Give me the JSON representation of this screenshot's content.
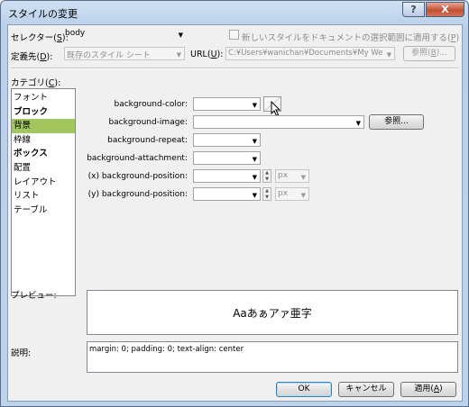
{
  "window": {
    "title": "スタイルの変更",
    "help_label": "?",
    "close_label": "X"
  },
  "selector": {
    "label": "セレクター(",
    "key": "S",
    "suffix": "):",
    "value": "body"
  },
  "apply_new_style": {
    "label": "新しいスタイルをドキュメントの選択範囲に適用する(",
    "key": "P",
    "suffix": ")",
    "checked": false
  },
  "define_in": {
    "label": "定義先(",
    "key": "D",
    "suffix": "):",
    "value": "既存のスタイル シート"
  },
  "url": {
    "label": "URL(",
    "key": "U",
    "suffix": "):",
    "value": "C:¥Users¥wanichan¥Documents¥My We"
  },
  "browse_url_button": {
    "label": "参照(",
    "key": "B",
    "suffix": ")..."
  },
  "category": {
    "label": "カテゴリ(",
    "key": "C",
    "suffix": "):",
    "items": [
      {
        "label": "フォント",
        "bold": false,
        "selected": false
      },
      {
        "label": "ブロック",
        "bold": true,
        "selected": false
      },
      {
        "label": "背景",
        "bold": false,
        "selected": true
      },
      {
        "label": "枠線",
        "bold": false,
        "selected": false
      },
      {
        "label": "ボックス",
        "bold": true,
        "selected": false
      },
      {
        "label": "配置",
        "bold": false,
        "selected": false
      },
      {
        "label": "レイアウト",
        "bold": false,
        "selected": false
      },
      {
        "label": "リスト",
        "bold": false,
        "selected": false
      },
      {
        "label": "テーブル",
        "bold": false,
        "selected": false
      }
    ]
  },
  "background": {
    "color_label": "background-color:",
    "color_value": "",
    "image_label": "background-image:",
    "image_value": "",
    "image_browse_label": "参照...",
    "repeat_label": "background-repeat:",
    "repeat_value": "",
    "attachment_label": "background-attachment:",
    "attachment_value": "",
    "pos_x_label": "(x) background-position:",
    "pos_x_value": "",
    "pos_x_unit": "px",
    "pos_y_label": "(y) background-position:",
    "pos_y_value": "",
    "pos_y_unit": "px"
  },
  "preview": {
    "label": "プレビュー:",
    "text": "Aaあぁアァ亜字"
  },
  "description": {
    "label": "説明:",
    "text": "margin: 0; padding: 0; text-align: center"
  },
  "buttons": {
    "ok": "OK",
    "cancel": "キャンセル",
    "apply": "適用(",
    "apply_key": "A",
    "apply_suffix": ")"
  },
  "colors": {
    "selected_category": "#a1c75e",
    "close_button": "#c44f32",
    "titlebar": "#bcd3ec"
  }
}
